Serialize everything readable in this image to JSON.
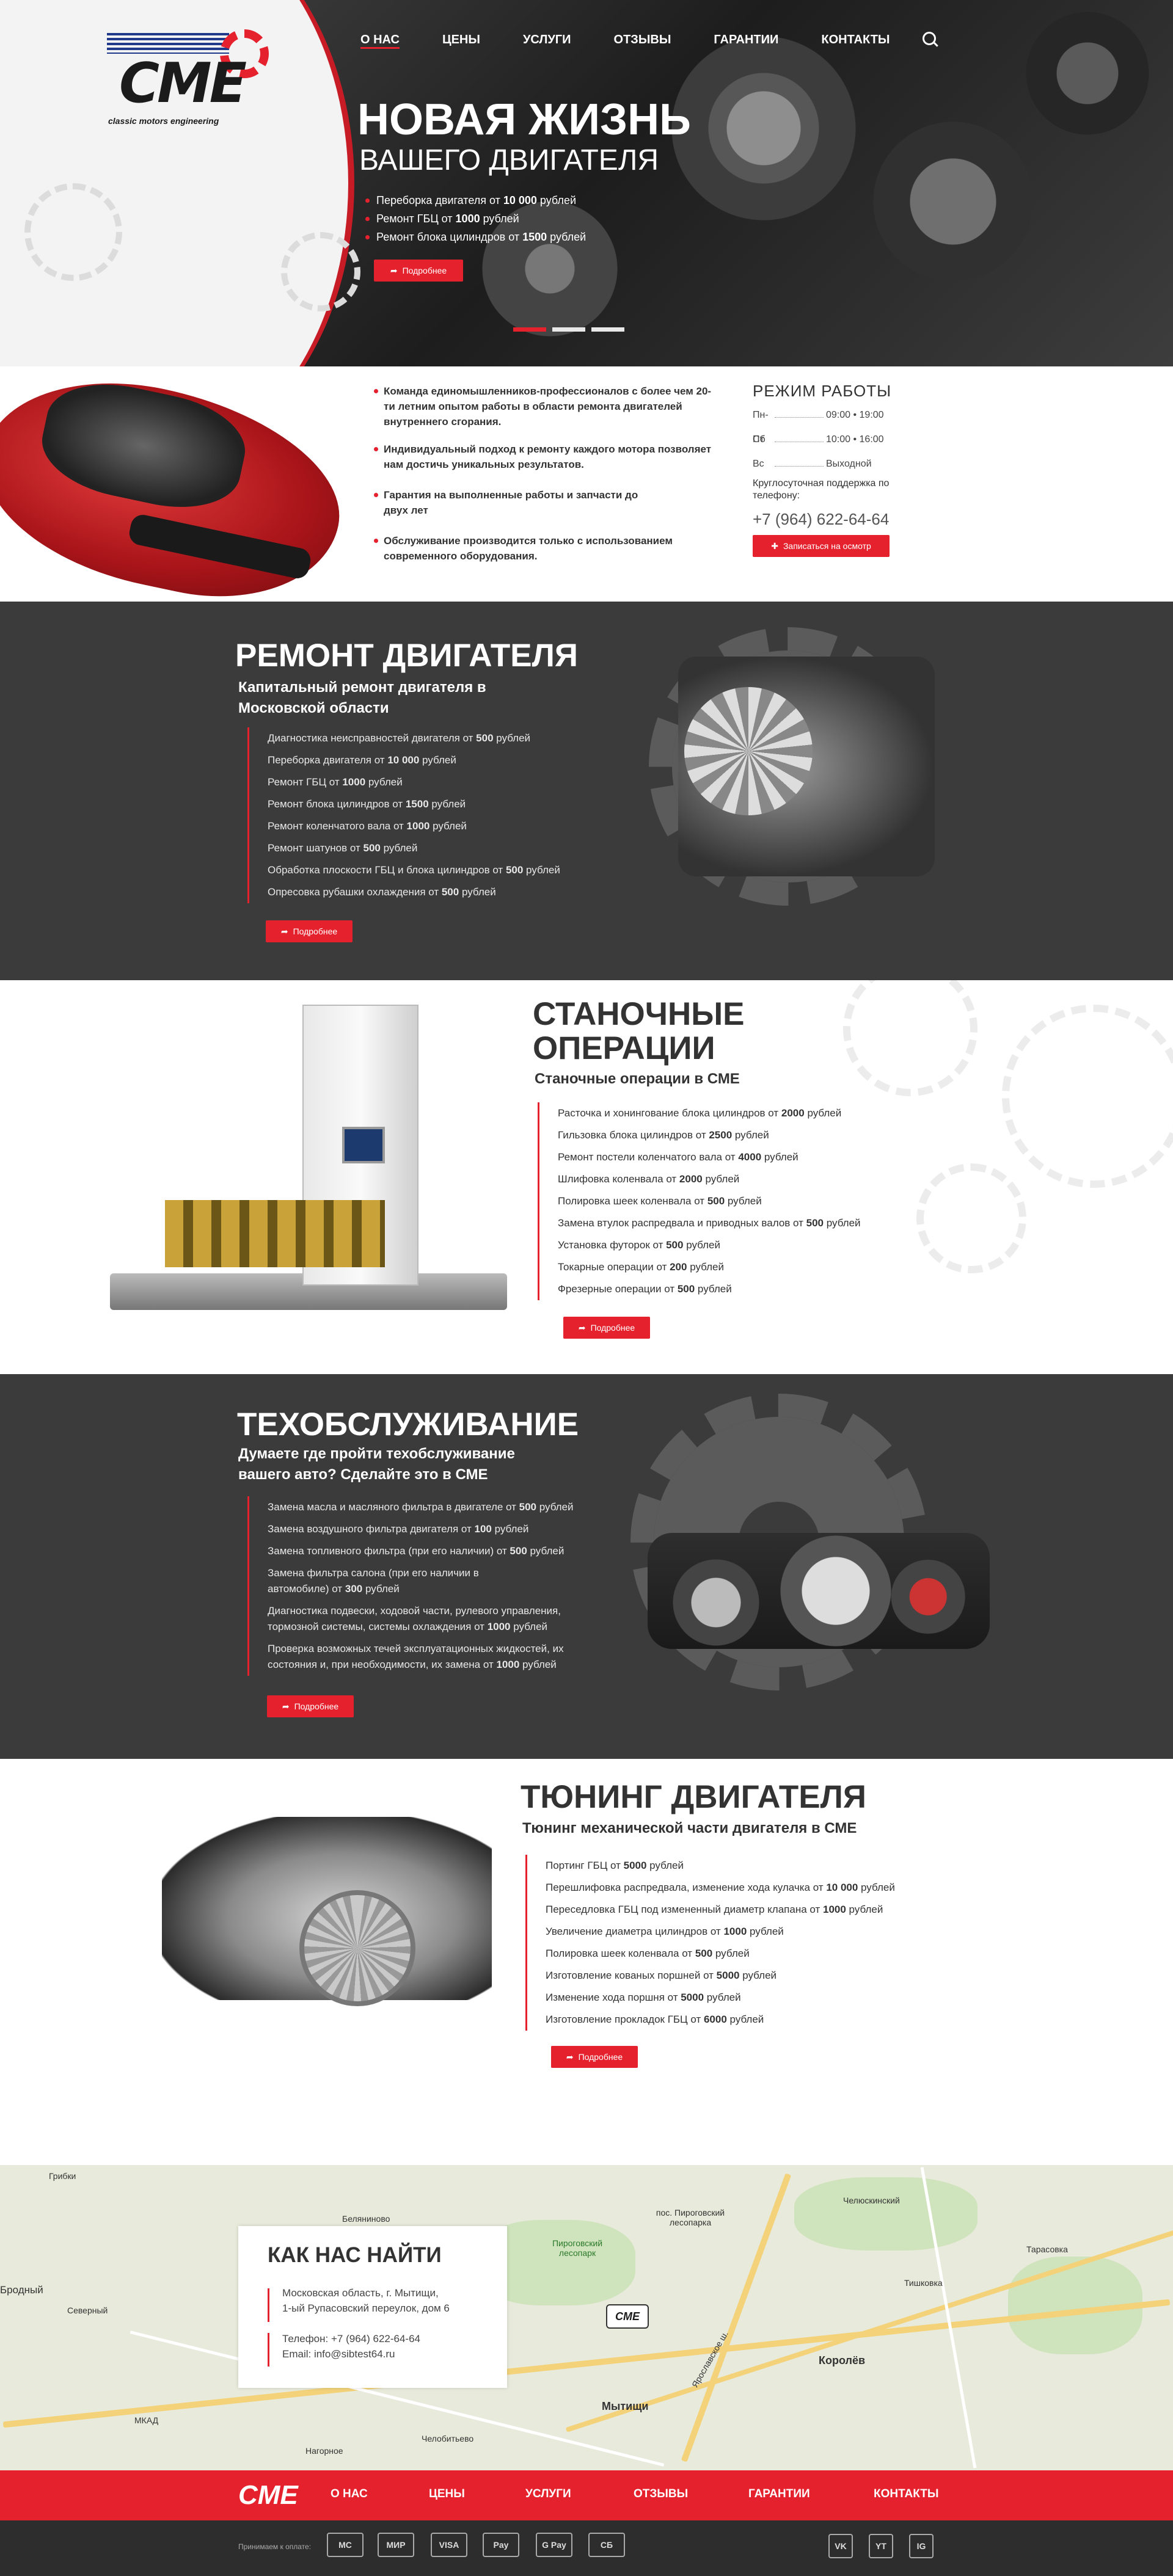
{
  "brand": {
    "logo_text": "CME",
    "tagline": "classic motors engineering"
  },
  "nav": {
    "items": [
      "О НАС",
      "ЦЕНЫ",
      "УСЛУГИ",
      "ОТЗЫВЫ",
      "ГАРАНТИИ",
      "КОНТАКТЫ"
    ],
    "active": "О НАС",
    "search_icon": "search-icon"
  },
  "hero": {
    "title": "НОВАЯ ЖИЗНЬ",
    "subtitle": "ВАШЕГО ДВИГАТЕЛЯ",
    "bullets": [
      {
        "pre": "Переборка двигателя от ",
        "b": "10 000",
        "post": " рублей"
      },
      {
        "pre": "Ремонт ГБЦ от ",
        "b": "1000",
        "post": " рублей"
      },
      {
        "pre": "Ремонт блока цилиндров от ",
        "b": "1500",
        "post": " рублей"
      }
    ],
    "button": "Подробнее",
    "slider_active": 1,
    "slider_count": 3
  },
  "info": {
    "features": [
      "Команда единомышленников-профессионалов с более чем 20-ти летним опытом работы в области ремонта двигателей внутреннего сгорания.",
      "Индивидуальный подход к ремонту каждого мотора позволяет нам достичь уникальных результатов.",
      "Гарантия на выполненные работы и запчасти до двух лет",
      "Обслуживание производится только с использованием современного оборудования."
    ],
    "hours": {
      "title": "РЕЖИМ РАБОТЫ",
      "rows": [
        {
          "day": "Пн-Пт",
          "time": "09:00 • 19:00"
        },
        {
          "day": "Сб",
          "time": "10:00 • 16:00"
        },
        {
          "day": "Вс",
          "time": "Выходной"
        }
      ],
      "support": "Круглосуточная поддержка по телефону:",
      "phone": "+7 (964) 622-64-64",
      "button": "Записаться на осмотр"
    }
  },
  "repair": {
    "title": "РЕМОНТ ДВИГАТЕЛЯ",
    "subtitle": "Капитальный ремонт двигателя в Московской области",
    "items": [
      {
        "pre": "Диагностика неисправностей двигателя от ",
        "b": "500",
        "post": " рублей"
      },
      {
        "pre": "Переборка двигателя от ",
        "b": "10 000",
        "post": " рублей"
      },
      {
        "pre": "Ремонт ГБЦ от ",
        "b": "1000",
        "post": " рублей"
      },
      {
        "pre": "Ремонт блока цилиндров от ",
        "b": "1500",
        "post": " рублей"
      },
      {
        "pre": "Ремонт коленчатого вала от ",
        "b": "1000",
        "post": " рублей"
      },
      {
        "pre": "Ремонт шатунов от ",
        "b": "500",
        "post": " рублей"
      },
      {
        "pre": "Обработка плоскости ГБЦ и блока цилиндров от ",
        "b": "500",
        "post": " рублей"
      },
      {
        "pre": "Опресовка рубашки охлаждения от ",
        "b": "500",
        "post": " рублей"
      }
    ],
    "button": "Подробнее"
  },
  "machining": {
    "title": [
      "СТАНОЧНЫЕ",
      "ОПЕРАЦИИ"
    ],
    "subtitle": "Станочные операции в СМЕ",
    "items": [
      {
        "pre": "Расточка и хонингование блока цилиндров от ",
        "b": "2000",
        "post": " рублей"
      },
      {
        "pre": "Гильзовка блока цилиндров от ",
        "b": "2500",
        "post": " рублей"
      },
      {
        "pre": "Ремонт постели коленчатого вала от ",
        "b": "4000",
        "post": " рублей"
      },
      {
        "pre": "Шлифовка коленвала от ",
        "b": "2000",
        "post": " рублей"
      },
      {
        "pre": "Полировка шеек коленвала от ",
        "b": "500",
        "post": " рублей"
      },
      {
        "pre": "Замена втулок распредвала и приводных валов от ",
        "b": "500",
        "post": " рублей"
      },
      {
        "pre": "Установка футорок от ",
        "b": "500",
        "post": " рублей"
      },
      {
        "pre": "Токарные операции от ",
        "b": "200",
        "post": " рублей"
      },
      {
        "pre": "Фрезерные операции от ",
        "b": "500",
        "post": " рублей"
      }
    ],
    "button": "Подробнее"
  },
  "service": {
    "title": "ТЕХОБСЛУЖИВАНИЕ",
    "subtitle": "Думаете где пройти техобслуживание вашего авто? Сделайте это в СМЕ",
    "items": [
      {
        "pre": "Замена масла и масляного фильтра в двигателе от ",
        "b": "500",
        "post": " рублей"
      },
      {
        "pre": "Замена воздушного фильтра двигателя от ",
        "b": "100",
        "post": " рублей"
      },
      {
        "pre": "Замена топливного фильтра (при его наличии) от ",
        "b": "500",
        "post": " рублей"
      },
      {
        "pre": "Замена фильтра салона (при его наличии в автомобиле) от ",
        "b": "300",
        "post": " рублей"
      },
      {
        "pre": "Диагностика подвески, ходовой части, рулевого управления, тормозной системы, системы охлаждения от ",
        "b": "1000",
        "post": " рублей"
      },
      {
        "pre": "Проверка возможных течей эксплуатационных жидкостей, их состояния и, при необходимости, их замена от ",
        "b": "1000",
        "post": " рублей"
      }
    ],
    "button": "Подробнее"
  },
  "tuning": {
    "title": "ТЮНИНГ ДВИГАТЕЛЯ",
    "subtitle": "Тюнинг механической части двигателя в СМЕ",
    "items": [
      {
        "pre": "Портинг ГБЦ от ",
        "b": "5000",
        "post": " рублей"
      },
      {
        "pre": "Перешлифовка распредвала, изменение хода кулачка от ",
        "b": "10 000",
        "post": " рублей"
      },
      {
        "pre": "Переседловка ГБЦ под измененный диаметр клапана от ",
        "b": "1000",
        "post": " рублей"
      },
      {
        "pre": "Увеличение диаметра цилиндров от ",
        "b": "1000",
        "post": " рублей"
      },
      {
        "pre": "Полировка шеек коленвала от ",
        "b": "500",
        "post": " рублей"
      },
      {
        "pre": "Изготовление кованых поршней от ",
        "b": "5000",
        "post": " рублей"
      },
      {
        "pre": "Изменение хода поршня от ",
        "b": "5000",
        "post": " рублей"
      },
      {
        "pre": "Изготовление прокладок ГБЦ от ",
        "b": "6000",
        "post": " рублей"
      }
    ],
    "button": "Подробнее"
  },
  "contacts": {
    "title": "КАК НАС НАЙТИ",
    "address": [
      "Московская область, г. Мытищи,",
      "1-ый Рупасовский переулок, дом 6"
    ],
    "phone": "Телефон: +7 (964) 622-64-64",
    "email": "Email: info@sibtest64.ru",
    "map_labels": [
      "Грибки",
      "Беляниново",
      "пос. Пироговский лесопарка",
      "Пироговский лесопарк",
      "Челюскинский",
      "Тарасовка",
      "Тишковка",
      "Мытищи",
      "Королёв",
      "Бродный",
      "Северный",
      "МКАД",
      "Челобитьево",
      "Нагорное",
      "Ярославское ш."
    ],
    "marker": "CME"
  },
  "footer": {
    "nav": [
      "О НАС",
      "ЦЕНЫ",
      "УСЛУГИ",
      "ОТЗЫВЫ",
      "ГАРАНТИИ",
      "КОНТАКТЫ"
    ],
    "pay_label": "Принимаем к оплате:",
    "pay": [
      "MC",
      "МИР",
      "VISA",
      "Pay",
      "G Pay",
      "СБ"
    ],
    "social": [
      "VK",
      "YT",
      "IG"
    ]
  },
  "colors": {
    "accent": "#e5212d",
    "dark": "#3b3b3b",
    "footer": "#2d2d2d"
  }
}
